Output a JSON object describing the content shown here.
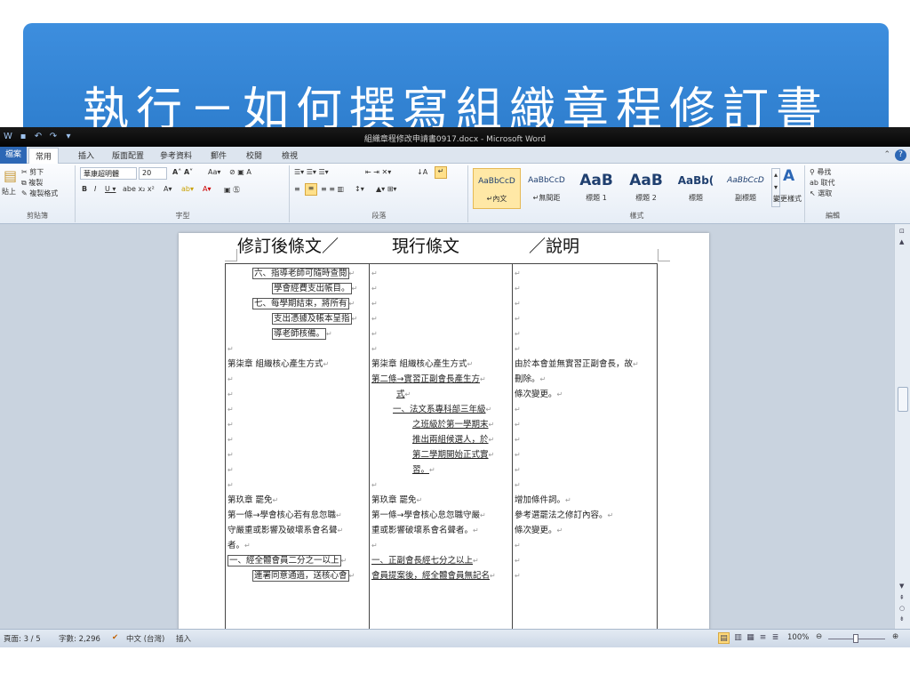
{
  "slide": {
    "title": "執行－如何撰寫組織章程修訂書"
  },
  "window": {
    "doc_title": "組織章程修改申請書0917.docx - Microsoft Word"
  },
  "tabs": [
    "檔案",
    "常用",
    "插入",
    "版面配置",
    "參考資料",
    "郵件",
    "校閱",
    "檢視"
  ],
  "ribbon": {
    "clipboard": {
      "label": "剪貼簿",
      "paste": "貼上",
      "cut": "剪下",
      "copy": "複製",
      "format_painter": "複製格式"
    },
    "font": {
      "label": "字型",
      "font_name": "華康超明體",
      "font_size": "20"
    },
    "paragraph": {
      "label": "段落"
    },
    "styles": {
      "label": "樣式",
      "tiles": [
        {
          "preview": "AaBbCcD",
          "name": "↵內文"
        },
        {
          "preview": "AaBbCcD",
          "name": "↵無間距"
        },
        {
          "preview": "AaB",
          "name": "標題 1"
        },
        {
          "preview": "AaB",
          "name": "標題 2"
        },
        {
          "preview": "AaBb(",
          "name": "標題"
        },
        {
          "preview": "AaBbCcD",
          "name": "副標題"
        }
      ],
      "change_styles": "變更樣式"
    },
    "editing": {
      "label": "編輯",
      "find": "尋找",
      "replace": "取代",
      "select": "選取"
    }
  },
  "document": {
    "heading": {
      "col1": "修訂後條文／",
      "col2": "現行條文",
      "col3": "／說明"
    },
    "col1_lines": [
      {
        "text": "六、指導老師可隨時查閱",
        "indent": 28,
        "style": "boxed"
      },
      {
        "text": "學會經費支出帳目。",
        "indent": 50,
        "style": "boxed"
      },
      {
        "text": "七、每學期結束，將所有",
        "indent": 28,
        "style": "boxed"
      },
      {
        "text": "支出憑據及帳本呈指",
        "indent": 50,
        "style": "boxed"
      },
      {
        "text": "導老師核備。",
        "indent": 50,
        "style": "boxed"
      },
      {
        "text": "",
        "indent": 0,
        "style": ""
      },
      {
        "text": "第柒章 組織核心產生方式",
        "indent": 0,
        "style": ""
      },
      {
        "text": "",
        "indent": 0,
        "style": ""
      },
      {
        "text": "",
        "indent": 0,
        "style": ""
      },
      {
        "text": "",
        "indent": 0,
        "style": ""
      },
      {
        "text": "",
        "indent": 0,
        "style": ""
      },
      {
        "text": "",
        "indent": 0,
        "style": ""
      },
      {
        "text": "",
        "indent": 0,
        "style": ""
      },
      {
        "text": "",
        "indent": 0,
        "style": ""
      },
      {
        "text": "",
        "indent": 0,
        "style": ""
      },
      {
        "text": "第玖章 罷免",
        "indent": 0,
        "style": ""
      },
      {
        "text": "第一條→學會核心若有怠忽職",
        "indent": 0,
        "style": ""
      },
      {
        "text": "守嚴重或影響及破壞系會名聲",
        "indent": 0,
        "style": ""
      },
      {
        "text": "者。",
        "indent": 0,
        "style": ""
      },
      {
        "text": "一、經全體會員二分之一以上",
        "indent": 0,
        "style": "boxed"
      },
      {
        "text": "連署同意通過，送核心會",
        "indent": 28,
        "style": "boxed"
      }
    ],
    "col2_lines": [
      {
        "text": "",
        "indent": 0,
        "style": ""
      },
      {
        "text": "",
        "indent": 0,
        "style": ""
      },
      {
        "text": "",
        "indent": 0,
        "style": ""
      },
      {
        "text": "",
        "indent": 0,
        "style": ""
      },
      {
        "text": "",
        "indent": 0,
        "style": ""
      },
      {
        "text": "",
        "indent": 0,
        "style": ""
      },
      {
        "text": "第柒章 組織核心產生方式",
        "indent": 0,
        "style": ""
      },
      {
        "text": "第二條→實習正副會長產生方",
        "indent": 0,
        "style": "strike"
      },
      {
        "text": "式",
        "indent": 28,
        "style": "strike"
      },
      {
        "text": "一、法文系專科部三年級",
        "indent": 24,
        "style": "strike"
      },
      {
        "text": "之班級於第一學期末",
        "indent": 46,
        "style": "strike"
      },
      {
        "text": "推出兩組候選人，於",
        "indent": 46,
        "style": "strike"
      },
      {
        "text": "第二學期開始正式實",
        "indent": 46,
        "style": "strike"
      },
      {
        "text": "習。",
        "indent": 46,
        "style": "strike"
      },
      {
        "text": "",
        "indent": 0,
        "style": ""
      },
      {
        "text": "第玖章 罷免",
        "indent": 0,
        "style": ""
      },
      {
        "text": "第一條→學會核心怠忽職守嚴",
        "indent": 0,
        "style": ""
      },
      {
        "text": "重或影響破壞系會名聲者。",
        "indent": 0,
        "style": ""
      },
      {
        "text": "",
        "indent": 0,
        "style": ""
      },
      {
        "text": "一、正副會長經七分之以上",
        "indent": 0,
        "style": "strike"
      },
      {
        "text": "會員提案後，經全體會員無記名",
        "indent": 0,
        "style": "strike"
      }
    ],
    "col3_lines": [
      {
        "text": "",
        "indent": 0,
        "style": ""
      },
      {
        "text": "",
        "indent": 0,
        "style": ""
      },
      {
        "text": "",
        "indent": 0,
        "style": ""
      },
      {
        "text": "",
        "indent": 0,
        "style": ""
      },
      {
        "text": "",
        "indent": 0,
        "style": ""
      },
      {
        "text": "",
        "indent": 0,
        "style": ""
      },
      {
        "text": "由於本會並無實習正副會長，故",
        "indent": 0,
        "style": ""
      },
      {
        "text": "刪除。",
        "indent": 0,
        "style": ""
      },
      {
        "text": "條次變更。",
        "indent": 0,
        "style": ""
      },
      {
        "text": "",
        "indent": 0,
        "style": ""
      },
      {
        "text": "",
        "indent": 0,
        "style": ""
      },
      {
        "text": "",
        "indent": 0,
        "style": ""
      },
      {
        "text": "",
        "indent": 0,
        "style": ""
      },
      {
        "text": "",
        "indent": 0,
        "style": ""
      },
      {
        "text": "",
        "indent": 0,
        "style": ""
      },
      {
        "text": "增加條件詞。",
        "indent": 0,
        "style": ""
      },
      {
        "text": "參考選罷法之修訂內容。",
        "indent": 0,
        "style": ""
      },
      {
        "text": "條次變更。",
        "indent": 0,
        "style": ""
      },
      {
        "text": "",
        "indent": 0,
        "style": ""
      },
      {
        "text": "",
        "indent": 0,
        "style": ""
      },
      {
        "text": "",
        "indent": 0,
        "style": ""
      }
    ]
  },
  "status": {
    "page": "頁面: 3 / 5",
    "words": "字數: 2,296",
    "language": "中文 (台灣)",
    "mode": "插入",
    "zoom": "100%"
  }
}
